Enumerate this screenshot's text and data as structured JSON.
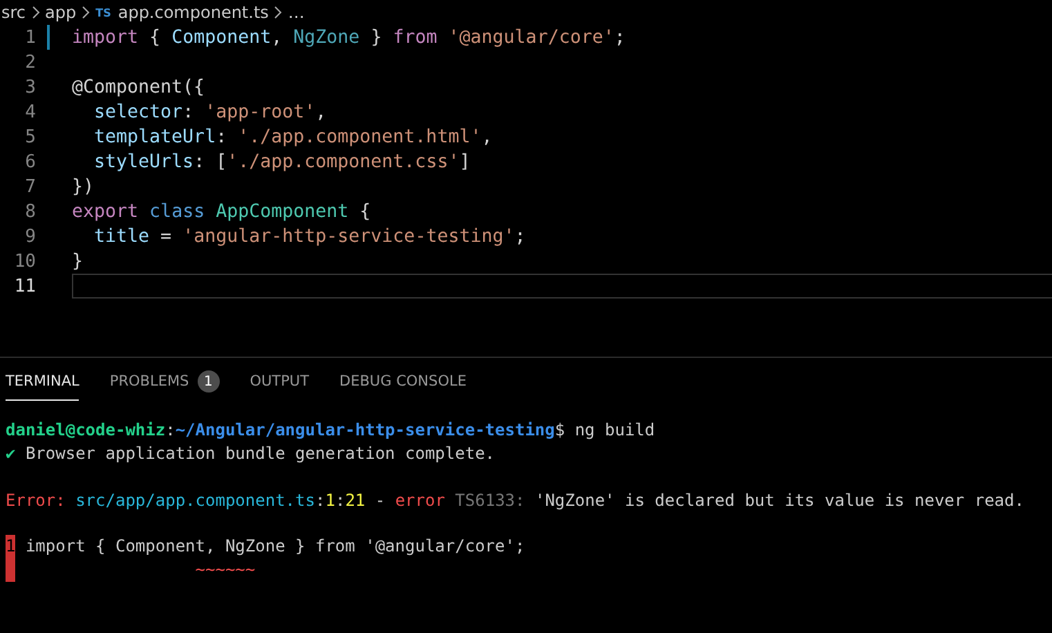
{
  "breadcrumb": {
    "items": [
      {
        "label": "src",
        "kind": "folder"
      },
      {
        "label": "app",
        "kind": "folder"
      },
      {
        "label": "app.component.ts",
        "kind": "ts-file",
        "badge": "TS"
      },
      {
        "label": "…",
        "kind": "more"
      }
    ]
  },
  "editor": {
    "lines": [
      {
        "number": "1",
        "active": false,
        "modified": true,
        "tokens": [
          {
            "text": "import",
            "kind": "keyword"
          },
          {
            "text": " { ",
            "kind": "punct"
          },
          {
            "text": "Component",
            "kind": "name"
          },
          {
            "text": ", ",
            "kind": "punct"
          },
          {
            "text": "NgZone",
            "kind": "unused"
          },
          {
            "text": " } ",
            "kind": "punct"
          },
          {
            "text": "from",
            "kind": "keyword"
          },
          {
            "text": " '@angular/core'",
            "kind": "string"
          },
          {
            "text": ";",
            "kind": "punct"
          }
        ]
      },
      {
        "number": "2",
        "active": false,
        "modified": false
      },
      {
        "number": "3",
        "active": false,
        "modified": false,
        "tokens": [
          {
            "text": "@Component({",
            "kind": "punct"
          }
        ]
      },
      {
        "number": "4",
        "active": false,
        "modified": false,
        "tokens": [
          {
            "text": "  selector",
            "kind": "name"
          },
          {
            "text": ": ",
            "kind": "punct"
          },
          {
            "text": "'app-root'",
            "kind": "string"
          },
          {
            "text": ",",
            "kind": "punct"
          }
        ]
      },
      {
        "number": "5",
        "active": false,
        "modified": false,
        "tokens": [
          {
            "text": "  templateUrl",
            "kind": "name"
          },
          {
            "text": ": ",
            "kind": "punct"
          },
          {
            "text": "'./app.component.html'",
            "kind": "string"
          },
          {
            "text": ",",
            "kind": "punct"
          }
        ]
      },
      {
        "number": "6",
        "active": false,
        "modified": false,
        "tokens": [
          {
            "text": "  styleUrls",
            "kind": "name"
          },
          {
            "text": ": [",
            "kind": "punct"
          },
          {
            "text": "'./app.component.css'",
            "kind": "string"
          },
          {
            "text": "]",
            "kind": "punct"
          }
        ]
      },
      {
        "number": "7",
        "active": false,
        "modified": false,
        "tokens": [
          {
            "text": "})",
            "kind": "punct"
          }
        ]
      },
      {
        "number": "8",
        "active": false,
        "modified": false,
        "tokens": [
          {
            "text": "export",
            "kind": "keyword"
          },
          {
            "text": " class",
            "kind": "declaration"
          },
          {
            "text": " AppComponent",
            "kind": "type"
          },
          {
            "text": " {",
            "kind": "punct"
          }
        ]
      },
      {
        "number": "9",
        "active": false,
        "modified": false,
        "tokens": [
          {
            "text": "  title",
            "kind": "name"
          },
          {
            "text": " = ",
            "kind": "punct"
          },
          {
            "text": "'angular-http-service-testing'",
            "kind": "string"
          },
          {
            "text": ";",
            "kind": "punct"
          }
        ]
      },
      {
        "number": "10",
        "active": false,
        "modified": false,
        "tokens": [
          {
            "text": "}",
            "kind": "punct"
          }
        ]
      },
      {
        "number": "11",
        "active": true,
        "modified": false
      }
    ]
  },
  "panel": {
    "tabs": [
      {
        "label": "TERMINAL",
        "selected": true
      },
      {
        "label": "PROBLEMS",
        "selected": false,
        "badge": "1"
      },
      {
        "label": "OUTPUT",
        "selected": false
      },
      {
        "label": "DEBUG CONSOLE",
        "selected": false
      }
    ],
    "terminal": [
      {
        "marker": false,
        "segments": [
          {
            "text": "daniel@code-whiz",
            "kind": "user"
          },
          {
            "text": ":",
            "kind": "plain"
          },
          {
            "text": "~/Angular/angular-http-service-testing",
            "kind": "path"
          },
          {
            "text": "$ ng build",
            "kind": "plain"
          }
        ]
      },
      {
        "marker": false,
        "segments": [
          {
            "text": "✔",
            "kind": "ok"
          },
          {
            "text": " Browser application bundle generation complete.",
            "kind": "plain"
          }
        ]
      },
      {
        "marker": false
      },
      {
        "marker": false,
        "segments": [
          {
            "text": "Error:",
            "kind": "error"
          },
          {
            "text": " src/app/app.component.ts",
            "kind": "link"
          },
          {
            "text": ":",
            "kind": "plain"
          },
          {
            "text": "1",
            "kind": "number"
          },
          {
            "text": ":",
            "kind": "plain"
          },
          {
            "text": "21",
            "kind": "number"
          },
          {
            "text": " - ",
            "kind": "plain"
          },
          {
            "text": "error",
            "kind": "error"
          },
          {
            "text": " TS6133:",
            "kind": "dim"
          },
          {
            "text": " 'NgZone' is declared but its value is never read.",
            "kind": "plain"
          }
        ]
      },
      {
        "marker": false
      },
      {
        "marker": true,
        "segments": [
          {
            "text": "1",
            "kind": "gutter"
          },
          {
            "text": " import { Component, NgZone } from '@angular/core';",
            "kind": "plain"
          }
        ]
      },
      {
        "marker": true,
        "segments": [
          {
            "text": "                   ~~~~~~",
            "kind": "error"
          }
        ]
      }
    ]
  }
}
